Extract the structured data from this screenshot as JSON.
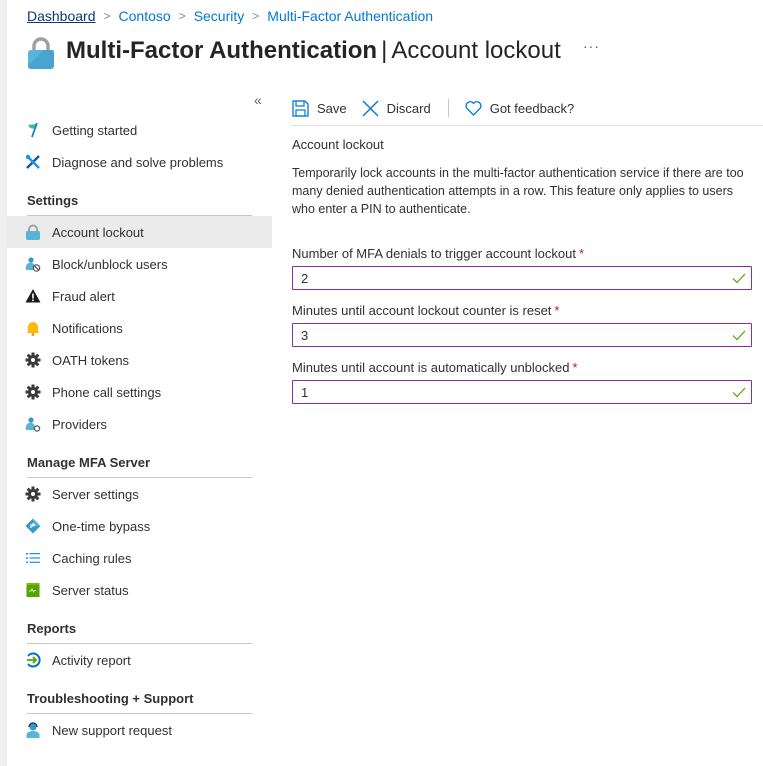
{
  "breadcrumb": [
    "Dashboard",
    "Contoso",
    "Security",
    "Multi-Factor Authentication"
  ],
  "header": {
    "title": "Multi-Factor Authentication",
    "separator": "|",
    "subtitle": "Account lockout",
    "more": "···"
  },
  "sidebar": {
    "collapse": "«",
    "top_items": [
      {
        "label": "Getting started",
        "icon": "rocket-flag-icon"
      },
      {
        "label": "Diagnose and solve problems",
        "icon": "wrench-screwdriver-icon"
      }
    ],
    "sections": [
      {
        "title": "Settings",
        "items": [
          {
            "label": "Account lockout",
            "icon": "lock-icon",
            "active": true
          },
          {
            "label": "Block/unblock users",
            "icon": "user-block-icon"
          },
          {
            "label": "Fraud alert",
            "icon": "warning-icon"
          },
          {
            "label": "Notifications",
            "icon": "bell-icon"
          },
          {
            "label": "OATH tokens",
            "icon": "gear-icon"
          },
          {
            "label": "Phone call settings",
            "icon": "gear-icon"
          },
          {
            "label": "Providers",
            "icon": "user-gear-icon"
          }
        ]
      },
      {
        "title": "Manage MFA Server",
        "items": [
          {
            "label": "Server settings",
            "icon": "gear-icon"
          },
          {
            "label": "One-time bypass",
            "icon": "diamond-arrow-icon"
          },
          {
            "label": "Caching rules",
            "icon": "list-icon"
          },
          {
            "label": "Server status",
            "icon": "server-status-icon"
          }
        ]
      },
      {
        "title": "Reports",
        "items": [
          {
            "label": "Activity report",
            "icon": "activity-report-icon"
          }
        ]
      },
      {
        "title": "Troubleshooting + Support",
        "items": [
          {
            "label": "New support request",
            "icon": "support-person-icon"
          }
        ]
      }
    ]
  },
  "toolbar": {
    "save": "Save",
    "discard": "Discard",
    "feedback": "Got feedback?"
  },
  "main": {
    "heading": "Account lockout",
    "description": "Temporarily lock accounts in the multi-factor authentication service if there are too many denied authentication attempts in a row. This feature only applies to users who enter a PIN to authenticate.",
    "fields": [
      {
        "label": "Number of MFA denials to trigger account lockout",
        "required": "*",
        "value": "2"
      },
      {
        "label": "Minutes until account lockout counter is reset",
        "required": "*",
        "value": "3"
      },
      {
        "label": "Minutes until account is automatically unblocked",
        "required": "*",
        "value": "1"
      }
    ]
  },
  "colors": {
    "accent": "#0078d4",
    "input_border": "#8a2da5",
    "valid_check": "#57a300",
    "required": "#a4262c",
    "active_bg": "#ebebeb"
  }
}
